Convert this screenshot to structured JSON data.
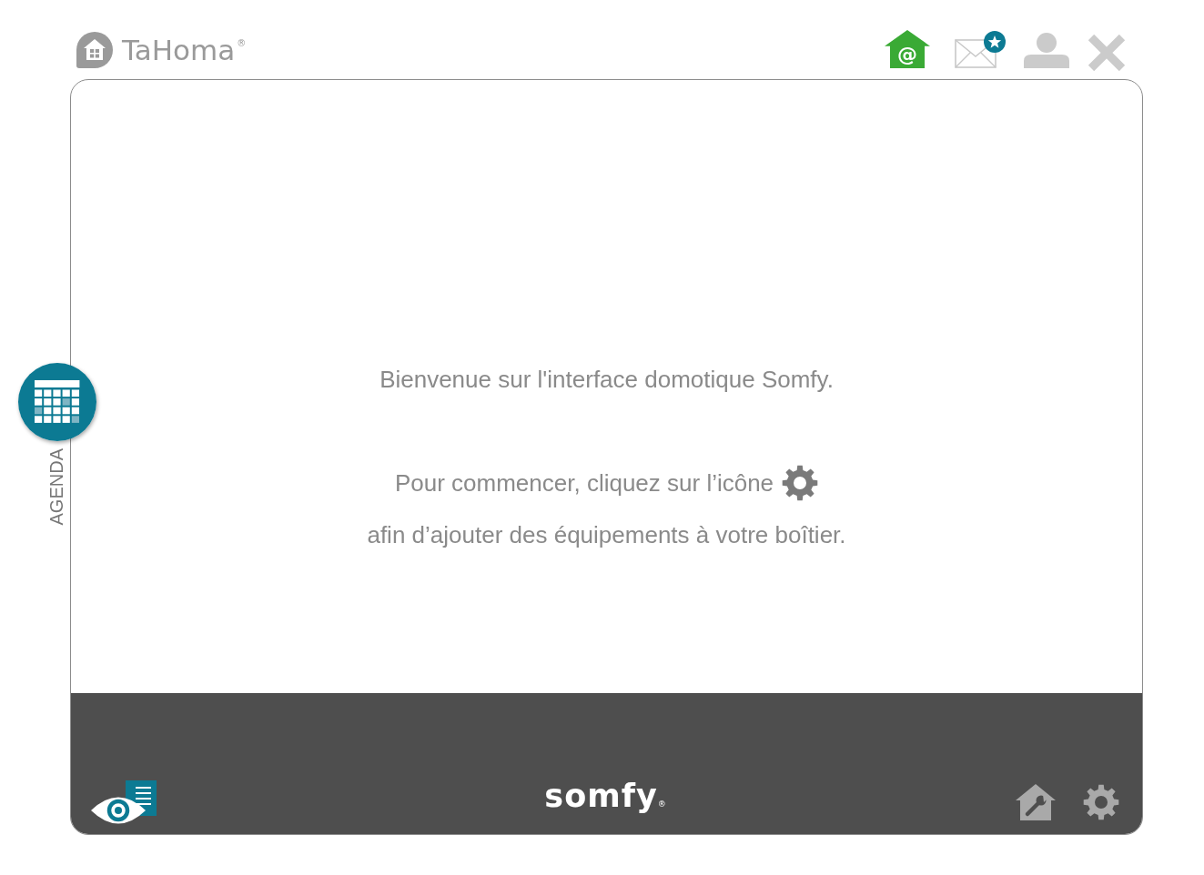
{
  "header": {
    "logo_text": "TaHoma$^{®}$"
  },
  "toolbar": [
    {
      "kind": "email-home",
      "label": "@"
    },
    {
      "kind": "messages",
      "badge": true
    },
    {
      "kind": "account"
    },
    {
      "kind": "close"
    }
  ],
  "agenda": {
    "label": "AGENDA"
  },
  "welcome": {
    "title": "Bienvenue sur l'interface domotique Somfy.",
    "instruction_line_1": "Pour commencer, cliquez sur l’icône",
    "instruction_line_2": "afin d’ajouter des équipements à votre boîtier."
  },
  "footer": {
    "logo_text": "somfy$_{®}$",
    "left_tools": [
      {
        "kind": "eye-document"
      }
    ],
    "right_tools": [
      {
        "kind": "house-wrench"
      },
      {
        "kind": "gear"
      }
    ]
  }
}
